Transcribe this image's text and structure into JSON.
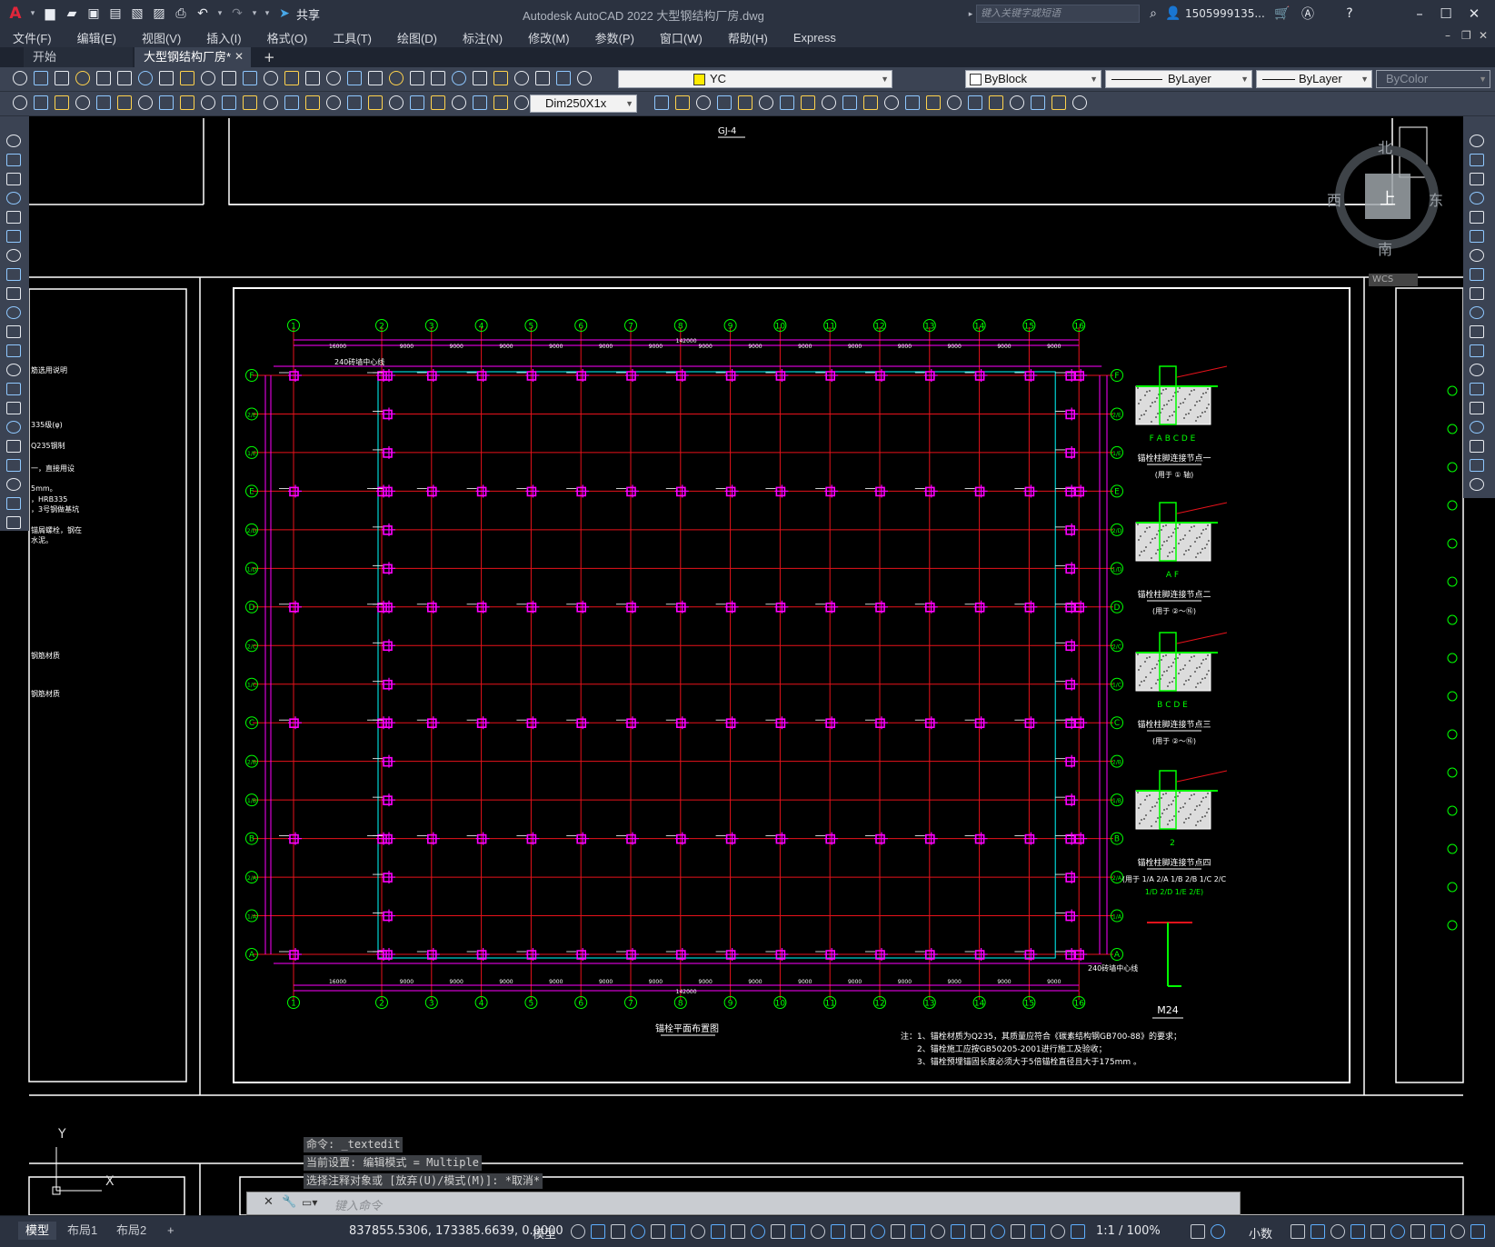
{
  "app": {
    "title": "Autodesk AutoCAD 2022    大型钢结构厂房.dwg",
    "logo_letter": "A",
    "share_label": "共享",
    "search_placeholder": "键入关键字或短语",
    "user": "1505999135...",
    "colors": {
      "accent": "#c8102e",
      "toolbar": "#3b4353",
      "titlebar": "#2b3240",
      "canvas": "#000000"
    }
  },
  "menu": [
    "文件(F)",
    "编辑(E)",
    "视图(V)",
    "插入(I)",
    "格式(O)",
    "工具(T)",
    "绘图(D)",
    "标注(N)",
    "修改(M)",
    "参数(P)",
    "窗口(W)",
    "帮助(H)",
    "Express"
  ],
  "tabs": [
    {
      "label": "开始",
      "active": false
    },
    {
      "label": "大型钢结构厂房*",
      "active": true
    }
  ],
  "toolbar": {
    "layer_value": "YC",
    "color_value": "ByBlock",
    "linetype_value": "ByLayer",
    "lineweight_value": "ByLayer",
    "plotstyle_value": "ByColor",
    "dimstyle_value": "Dim250X1x"
  },
  "viewcube": {
    "north": "北",
    "south": "南",
    "east": "东",
    "west": "西",
    "top": "上",
    "wcs": "WCS"
  },
  "drawing": {
    "frame_label_top": "GJ-4",
    "grid_x": [
      "1",
      "2",
      "3",
      "4",
      "5",
      "6",
      "7",
      "8",
      "9",
      "10",
      "11",
      "12",
      "13",
      "14",
      "15",
      "16"
    ],
    "grid_y": [
      "F",
      "2/E",
      "1/E",
      "E",
      "2/D",
      "1/D",
      "D",
      "2/C",
      "1/C",
      "C",
      "2/B",
      "1/B",
      "B",
      "2/A",
      "1/A",
      "A"
    ],
    "span_top": [
      "16000",
      "9000",
      "9000",
      "9000",
      "9000",
      "9000",
      "9000",
      "9000",
      "9000",
      "9000",
      "9000",
      "9000",
      "9000",
      "9000",
      "9000"
    ],
    "span_total": "142000",
    "wall_label_top": "240砖墙中心线",
    "wall_label_bottom": "240砖墙中心线",
    "plan_title": "锚栓平面布置图",
    "details": [
      {
        "title": "锚栓柱脚连接节点一",
        "sub": "(用于 ① 轴)",
        "axes": "F A B C D E"
      },
      {
        "title": "锚栓柱脚连接节点二",
        "sub": "(用于 ②～⑯)",
        "axes": "A F"
      },
      {
        "title": "锚栓柱脚连接节点三",
        "sub": "(用于 ②～⑯)",
        "axes": "B C D E"
      },
      {
        "title": "锚栓柱脚连接节点四",
        "sub": "(用于 1/A 2/A 1/B 2/B 1/C 2/C",
        "sub2": "1/D 2/D 1/E 2/E)",
        "axes": "2"
      }
    ],
    "bolt_label": "M24",
    "notes": [
      "注：1、锚栓材质为Q235，其质量应符合《碳素结构钢GB700-88》的要求；",
      "2、锚栓施工应按GB50205-2001进行施工及验收；",
      "3、锚栓预埋锚固长度必须大于5倍锚栓直径且大于175mm 。"
    ],
    "left_notes": [
      "筋选用说明",
      "335级(φ)",
      "Q235钢制",
      "一，直接用设",
      "5mm。",
      "，HRB335",
      "，3号钢做基坑",
      "锚屑螺栓，钢在",
      "水泥。",
      "钢筋材质",
      "钢筋材质"
    ]
  },
  "command": {
    "history": [
      "命令: _textedit",
      "当前设置: 编辑模式 = Multiple",
      "选择注释对象或 [放弃(U)/模式(M)]: *取消*"
    ],
    "placeholder": "键入命令"
  },
  "ucs": {
    "y": "Y",
    "x": "X"
  },
  "status": {
    "layouts": [
      {
        "label": "模型",
        "active": true
      },
      {
        "label": "布局1",
        "active": false
      },
      {
        "label": "布局2",
        "active": false
      }
    ],
    "coords": "837855.5306, 173385.6639, 0.0000",
    "model_label": "模型",
    "scale": "1:1 / 100%",
    "units": "小数"
  }
}
